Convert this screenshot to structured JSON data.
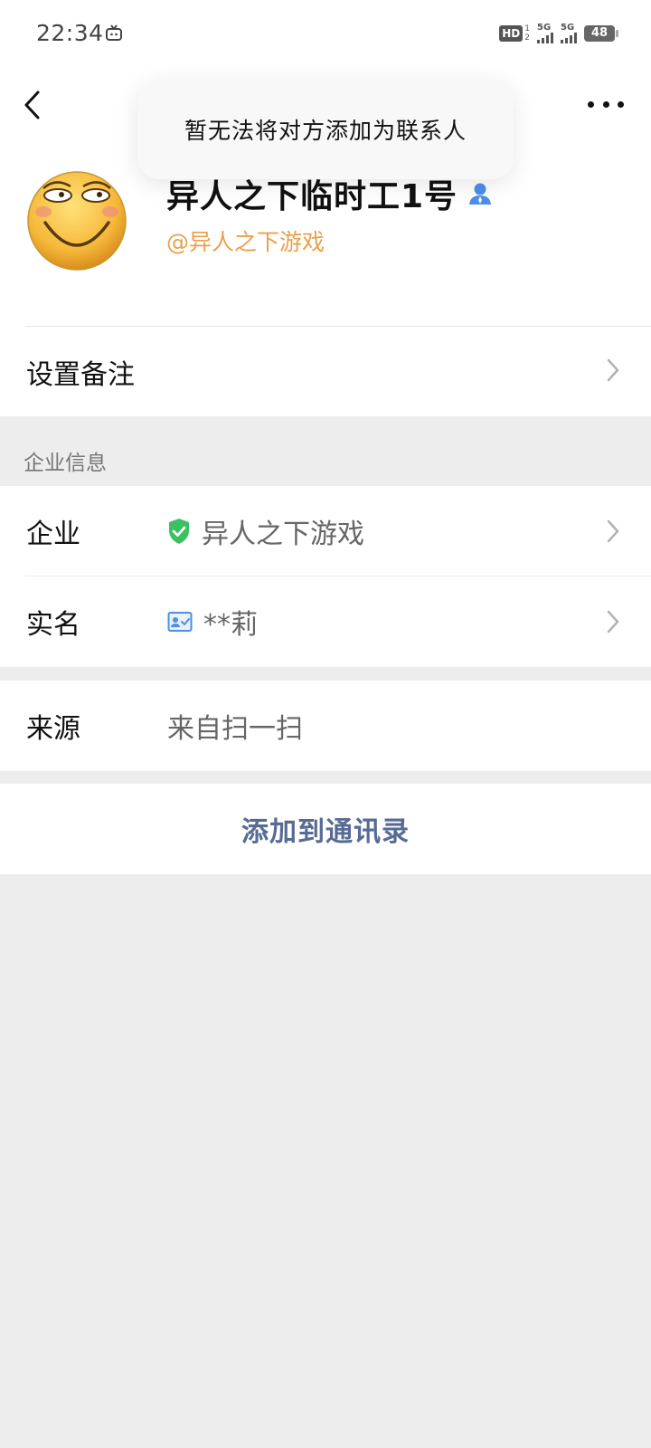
{
  "status_bar": {
    "time": "22:34",
    "hd_label": "HD",
    "hd_sub_top": "1",
    "hd_sub_bottom": "2",
    "network_1": "5G",
    "network_2": "5G",
    "battery": "48"
  },
  "nav": {
    "back_icon": "chevron-left-icon",
    "more_icon": "more-dots-icon"
  },
  "toast": {
    "message": "暂无法将对方添加为联系人"
  },
  "profile": {
    "name": "异人之下临时工1号",
    "handle": "@异人之下游戏",
    "handle_color": "#e9a04a"
  },
  "remark_row": {
    "label": "设置备注"
  },
  "enterprise_section": {
    "title": "企业信息",
    "company_label": "企业",
    "company_value": "异人之下游戏",
    "realname_label": "实名",
    "realname_value": "**莉"
  },
  "source_row": {
    "label": "来源",
    "value": "来自扫一扫"
  },
  "add_button": {
    "label": "添加到通讯录",
    "color": "#576b95"
  }
}
